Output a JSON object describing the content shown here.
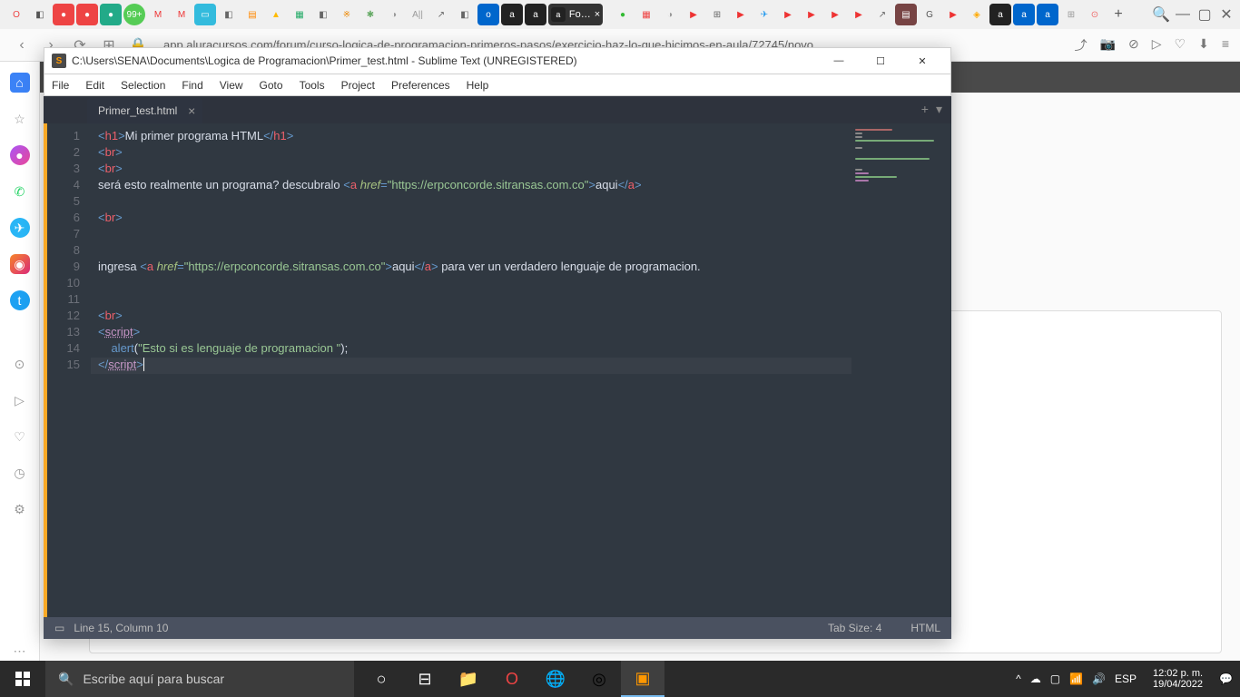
{
  "browser": {
    "url": "app.aluracursos.com/forum/curso-logica-de-programacion-primeros-pasos/exercicio-haz-lo-que-hicimos-en-aula/72745/novo",
    "active_tab_text": "Fo…",
    "active_tab_close": "×"
  },
  "sublime": {
    "titlebar": "C:\\Users\\SENA\\Documents\\Logica de Programacion\\Primer_test.html - Sublime Text (UNREGISTERED)",
    "menu": [
      "File",
      "Edit",
      "Selection",
      "Find",
      "View",
      "Goto",
      "Tools",
      "Project",
      "Preferences",
      "Help"
    ],
    "tab": "Primer_test.html",
    "tab_close": "●",
    "status_left_icon": "▭",
    "status_left": "Line 15, Column 10",
    "status_tab": "Tab Size: 4",
    "status_lang": "HTML",
    "line_numbers": [
      "1",
      "2",
      "3",
      "4",
      "5",
      "6",
      "7",
      "8",
      "9",
      "10",
      "11",
      "12",
      "13",
      "14",
      "15"
    ],
    "code": {
      "l1_h1_open": "h1",
      "l1_text": "Mi primer programa HTML",
      "l1_h1_close": "h1",
      "br": "br",
      "l4_pre": "será esto realmente un programa? descubralo ",
      "l4_attr": "href",
      "l4_url": "\"https://erpconcorde.sitransas.com.co\"",
      "l4_aqui": "aqui",
      "l9_pre": "ingresa ",
      "l9_attr": "href",
      "l9_url": "\"https://erpconcorde.sitransas.com.co\"",
      "l9_aqui": "aqui",
      "l9_post": " para ver un verdadero lenguaje de programacion.",
      "script_tag": "script",
      "alert": "alert",
      "alert_str": "\"Esto si es lenguaje de programacion \"",
      "alert_end": ");",
      "a_tag": "a"
    }
  },
  "taskbar": {
    "search_placeholder": "Escribe aquí para buscar",
    "lang": "ESP",
    "time": "12:02 p. m.",
    "date": "19/04/2022"
  }
}
